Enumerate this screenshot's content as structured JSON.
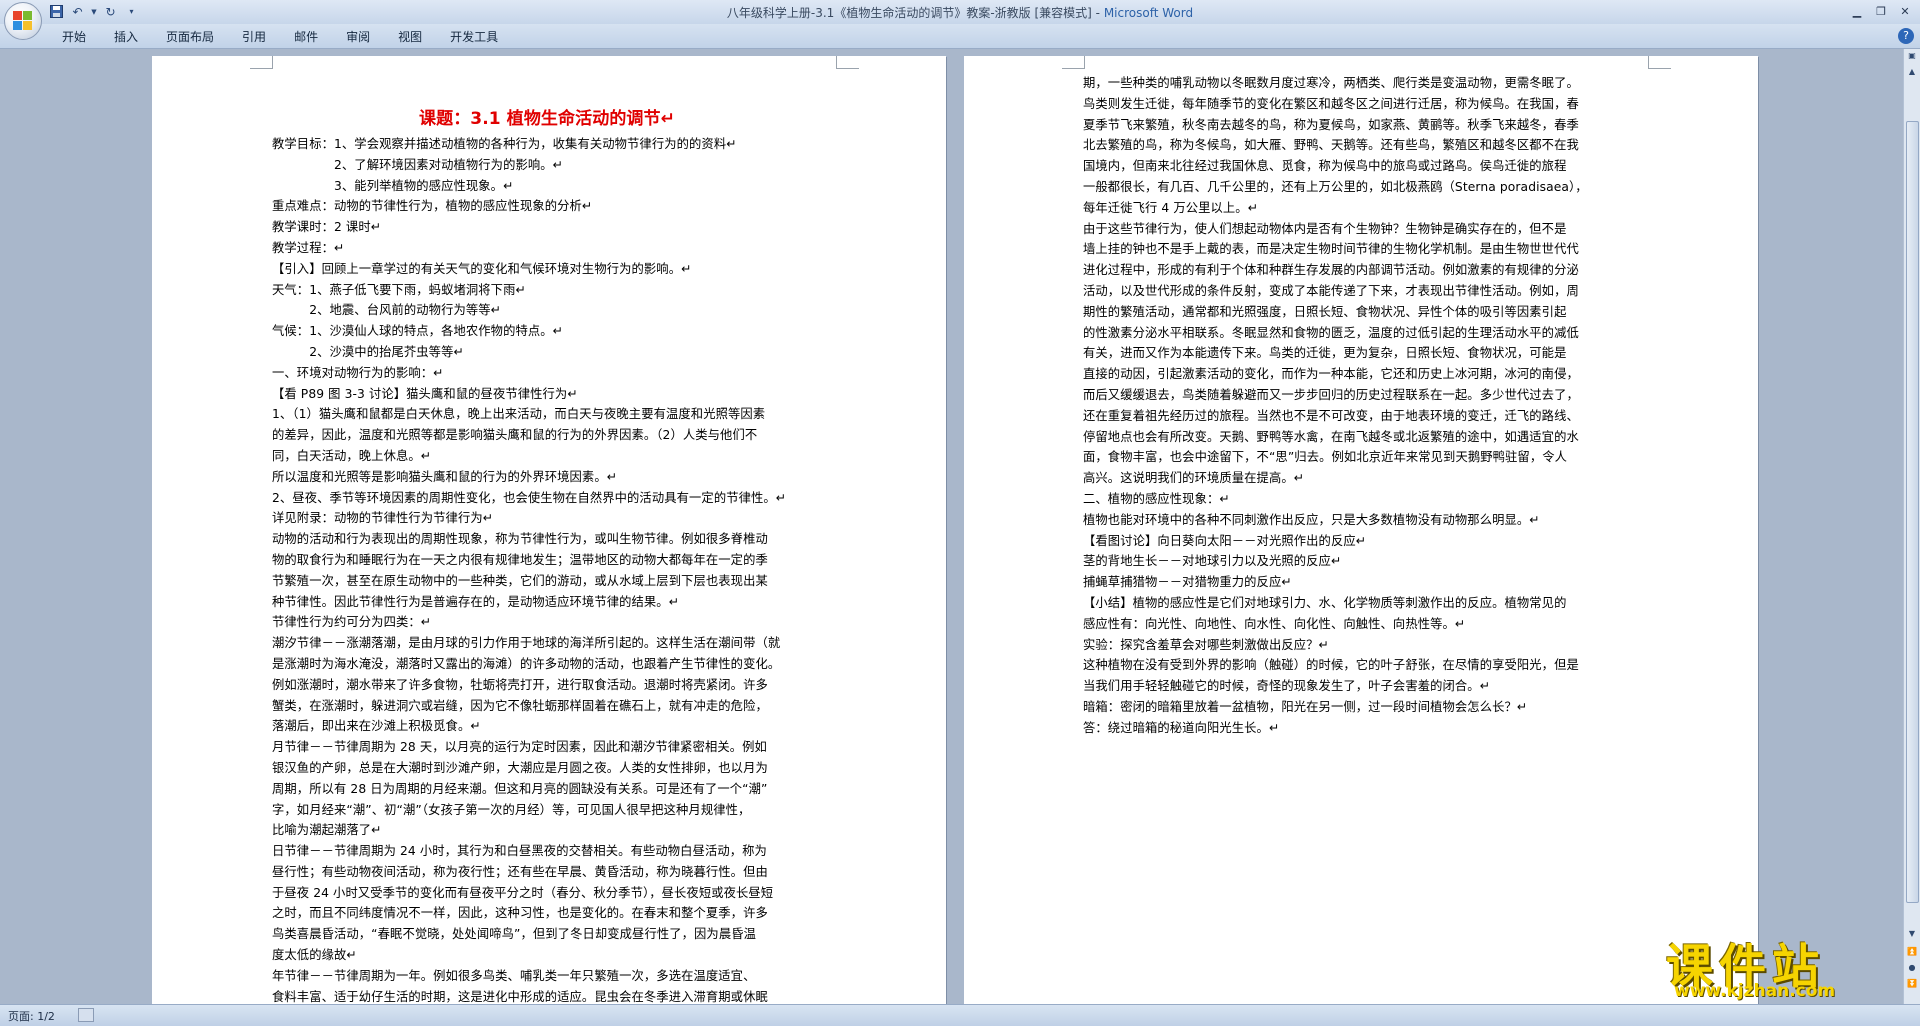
{
  "window": {
    "title_doc": "八年级科学上册-3.1《植物生命活动的调节》教案-浙教版 [兼容模式]",
    "title_sep": " - ",
    "title_app": "Microsoft Word"
  },
  "ribbon": {
    "tabs": [
      "开始",
      "插入",
      "页面布局",
      "引用",
      "邮件",
      "审阅",
      "视图",
      "开发工具"
    ],
    "help_label": "?"
  },
  "page1": {
    "title": "课题：3.1 植物生命活动的调节↵",
    "lines": [
      "教学目标：1、学会观察并描述动植物的各种行为，收集有关动物节律行为的的资料↵",
      "　　　　　2、了解环境因素对动植物行为的影响。↵",
      "　　　　　3、能列举植物的感应性现象。↵",
      "重点难点：动物的节律性行为，植物的感应性现象的分析↵",
      "教学课时：2 课时↵",
      "教学过程：↵",
      "【引入】回顾上一章学过的有关天气的变化和气候环境对生物行为的影响。↵",
      "天气：1、燕子低飞要下雨，蚂蚁堵洞将下雨↵",
      "　　　2、地震、台风前的动物行为等等↵",
      " 气候：1、沙漠仙人球的特点，各地农作物的特点。↵",
      "　　　2、沙漠中的抬尾芥虫等等↵",
      "一、环境对动物行为的影响：↵",
      "【看 P89 图 3-3 讨论】猫头鹰和鼠的昼夜节律性行为↵",
      "1、（1）猫头鹰和鼠都是白天休息，晚上出来活动，而白天与夜晚主要有温度和光照等因素",
      "的差异，因此，温度和光照等都是影响猫头鹰和鼠的行为的外界因素。（2）人类与他们不",
      "同，白天活动，晚上休息。↵",
      "所以温度和光照等是影响猫头鹰和鼠的行为的外界环境因素。↵",
      "2、昼夜、季节等环境因素的周期性变化，也会使生物在自然界中的活动具有一定的节律性。↵",
      "详见附录：动物的节律性行为节律行为↵",
      "动物的活动和行为表现出的周期性现象，称为节律性行为，或叫生物节律。例如很多脊椎动",
      "物的取食行为和睡眠行为在一天之内很有规律地发生；温带地区的动物大都每年在一定的季",
      "节繁殖一次，甚至在原生动物中的一些种类，它们的游动，或从水域上层到下层也表现出某",
      "种节律性。因此节律性行为是普遍存在的，是动物适应环境节律的结果。↵",
      "节律性行为约可分为四类：↵",
      "潮汐节律－－涨潮落潮，是由月球的引力作用于地球的海洋所引起的。这样生活在潮间带（就",
      "是涨潮时为海水淹没，潮落时又露出的海滩）的许多动物的活动，也跟着产生节律性的变化。",
      "例如涨潮时，潮水带来了许多食物，牡蛎将壳打开，进行取食活动。退潮时将壳紧闭。许多",
      "蟹类，在涨潮时，躲进洞穴或岩缝，因为它不像牡蛎那样固着在礁石上，就有冲走的危险，",
      "落潮后，即出来在沙滩上积极觅食。↵",
      "月节律－－节律周期为 28 天，以月亮的运行为定时因素，因此和潮汐节律紧密相关。例如",
      "银汉鱼的产卵，总是在大潮时到沙滩产卵，大潮应是月圆之夜。人类的女性排卵，也以月为",
      "周期，所以有 28 日为周期的月经来潮。但这和月亮的圆缺没有关系。可是还有了一个“潮”",
      "字，如月经来“潮”、初“潮”（女孩子第一次的月经）等，可见国人很早把这种月规律性，",
      "比喻为潮起潮落了↵",
      "日节律－－节律周期为 24 小时，其行为和白昼黑夜的交替相关。有些动物白昼活动，称为",
      "昼行性；有些动物夜间活动，称为夜行性；还有些在早晨、黄昏活动，称为晓暮行性。但由",
      "于昼夜 24 小时又受季节的变化而有昼夜平分之时（春分、秋分季节），昼长夜短或夜长昼短",
      "之时，而且不同纬度情况不一样，因此，这种习性，也是变化的。在春末和整个夏季，许多",
      "鸟类喜晨昏活动，“春眠不觉晓，处处闻啼鸟”，但到了冬日却变成昼行性了，因为晨昏温",
      "度太低的缘故↵",
      "年节律－－节律周期为一年。例如很多鸟类、哺乳类一年只繁殖一次，多选在温度适宜、",
      "食料丰富、适于幼仔生活的时期，这是进化中形成的适应。昆虫会在冬季进入滞育期或休眠"
    ]
  },
  "page2": {
    "lines": [
      "期，一些种类的哺乳动物以冬眠数月度过寒冷，两栖类、爬行类是变温动物，更需冬眠了。",
      "鸟类则发生迁徙，每年随季节的变化在繁区和越冬区之间进行迁居，称为候鸟。在我国，春",
      "夏季节飞来繁殖，秋冬南去越冬的鸟，称为夏候鸟，如家燕、黄鹂等。秋季飞来越冬，春季",
      "北去繁殖的鸟，称为冬候鸟，如大雁、野鸭、天鹅等。还有些鸟，繁殖区和越冬区都不在我",
      "国境内，但南来北往经过我国休息、觅食，称为候鸟中的旅鸟或过路鸟。侯鸟迁徙的旅程",
      "一般都很长，有几百、几千公里的，还有上万公里的，如北极燕鸥（Sterna poradisaea），",
      "每年迁徙飞行 4 万公里以上。↵",
      "由于这些节律行为，使人们想起动物体内是否有个生物钟？生物钟是确实存在的，但不是",
      "墙上挂的钟也不是手上戴的表，而是决定生物时间节律的生物化学机制。是由生物世世代代",
      "进化过程中，形成的有利于个体和种群生存发展的内部调节活动。例如激素的有规律的分泌",
      "活动，以及世代形成的条件反射，变成了本能传递了下来，才表现出节律性活动。例如，周",
      "期性的繁殖活动，通常都和光照强度，日照长短、食物状况、异性个体的吸引等因素引起",
      "的性激素分泌水平相联系。冬眠显然和食物的匮乏，温度的过低引起的生理活动水平的减低",
      "有关，进而又作为本能遗传下来。鸟类的迁徙，更为复杂，日照长短、食物状况，可能是",
      "直接的动因，引起激素活动的变化，而作为一种本能，它还和历史上冰河期，冰河的南侵，",
      "而后又缓缓退去，鸟类随着躲避而又一步步回归的历史过程联系在一起。多少世代过去了，",
      "还在重复着祖先经历过的旅程。当然也不是不可改变，由于地表环境的变迁，迁飞的路线、",
      "停留地点也会有所改变。天鹅、野鸭等水禽，在南飞越冬或北返繁殖的途中，如遇适宜的水",
      "面，食物丰富，也会中途留下，不“思”归去。例如北京近年来常见到天鹅野鸭驻留，令人",
      "高兴。这说明我们的环境质量在提高。↵",
      "二、植物的感应性现象：↵",
      "植物也能对环境中的各种不同刺激作出反应，只是大多数植物没有动物那么明显。↵",
      "【看图讨论】向日葵向太阳－－对光照作出的反应↵",
      "茎的背地生长－－对地球引力以及光照的反应↵",
      "捕蝇草捕猎物－－对猎物重力的反应↵",
      "【小结】植物的感应性是它们对地球引力、水、化学物质等刺激作出的反应。植物常见的",
      "感应性有：向光性、向地性、向水性、向化性、向触性、向热性等。↵",
      "实验：探究含羞草会对哪些刺激做出反应？↵",
      "这种植物在没有受到外界的影响（触碰）的时候，它的叶子舒张，在尽情的享受阳光，但是",
      "当我们用手轻轻触碰它的时候，奇怪的现象发生了，叶子会害羞的闭合。↵",
      "暗箱：密闭的暗箱里放着一盆植物，阳光在另一侧，过一段时间植物会怎么长？↵",
      "答：绕过暗箱的秘道向阳光生长。↵"
    ]
  },
  "status": {
    "page_label": "页面: 1/2"
  },
  "watermark": {
    "big": "课件站",
    "url": "www.kjzhan.com"
  }
}
